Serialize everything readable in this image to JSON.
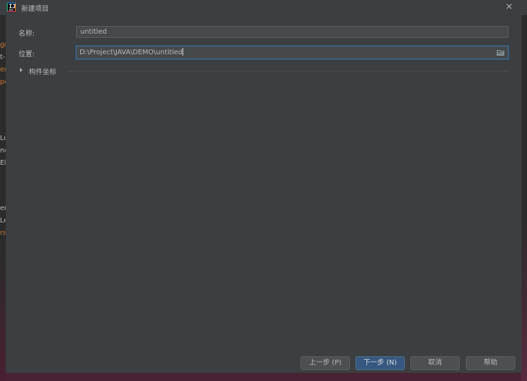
{
  "window": {
    "title": "新建项目",
    "close_glyph": "✕"
  },
  "form": {
    "name_label": "名称:",
    "name_value": "untitled",
    "location_label": "位置:",
    "location_value": "D:\\Project\\JAVA\\DEMO\\untitled",
    "artifact_coords_label": "构件坐标"
  },
  "buttons": {
    "previous": "上一步 (P)",
    "next": "下一步 (N)",
    "cancel": "取消",
    "help": "帮助"
  },
  "background_fragments": [
    {
      "text": "gr",
      "color": "#cc7832"
    },
    {
      "text": "t-",
      "color": "#bbbbbb"
    },
    {
      "text": "er",
      "color": "#cc7832"
    },
    {
      "text": "pe",
      "color": "#cc7832"
    },
    {
      "text": "Lu",
      "color": "#bbbbbb"
    },
    {
      "text": "nc",
      "color": "#bbbbbb"
    },
    {
      "text": "El",
      "color": "#bbbbbb"
    },
    {
      "text": "er",
      "color": "#bbbbbb"
    },
    {
      "text": "Le",
      "color": "#bbbbbb"
    },
    {
      "text": "rs",
      "color": "#cc7832"
    }
  ],
  "icons": {
    "app": "intellij-idea-icon",
    "browse": "folder-open-icon",
    "expand": "triangle-right-icon",
    "close": "close-icon"
  },
  "colors": {
    "dialog_bg": "#3c3f41",
    "input_bg": "#45494a",
    "focus_border": "#3d6185",
    "primary_button": "#365880",
    "button_bg": "#4c5052"
  }
}
